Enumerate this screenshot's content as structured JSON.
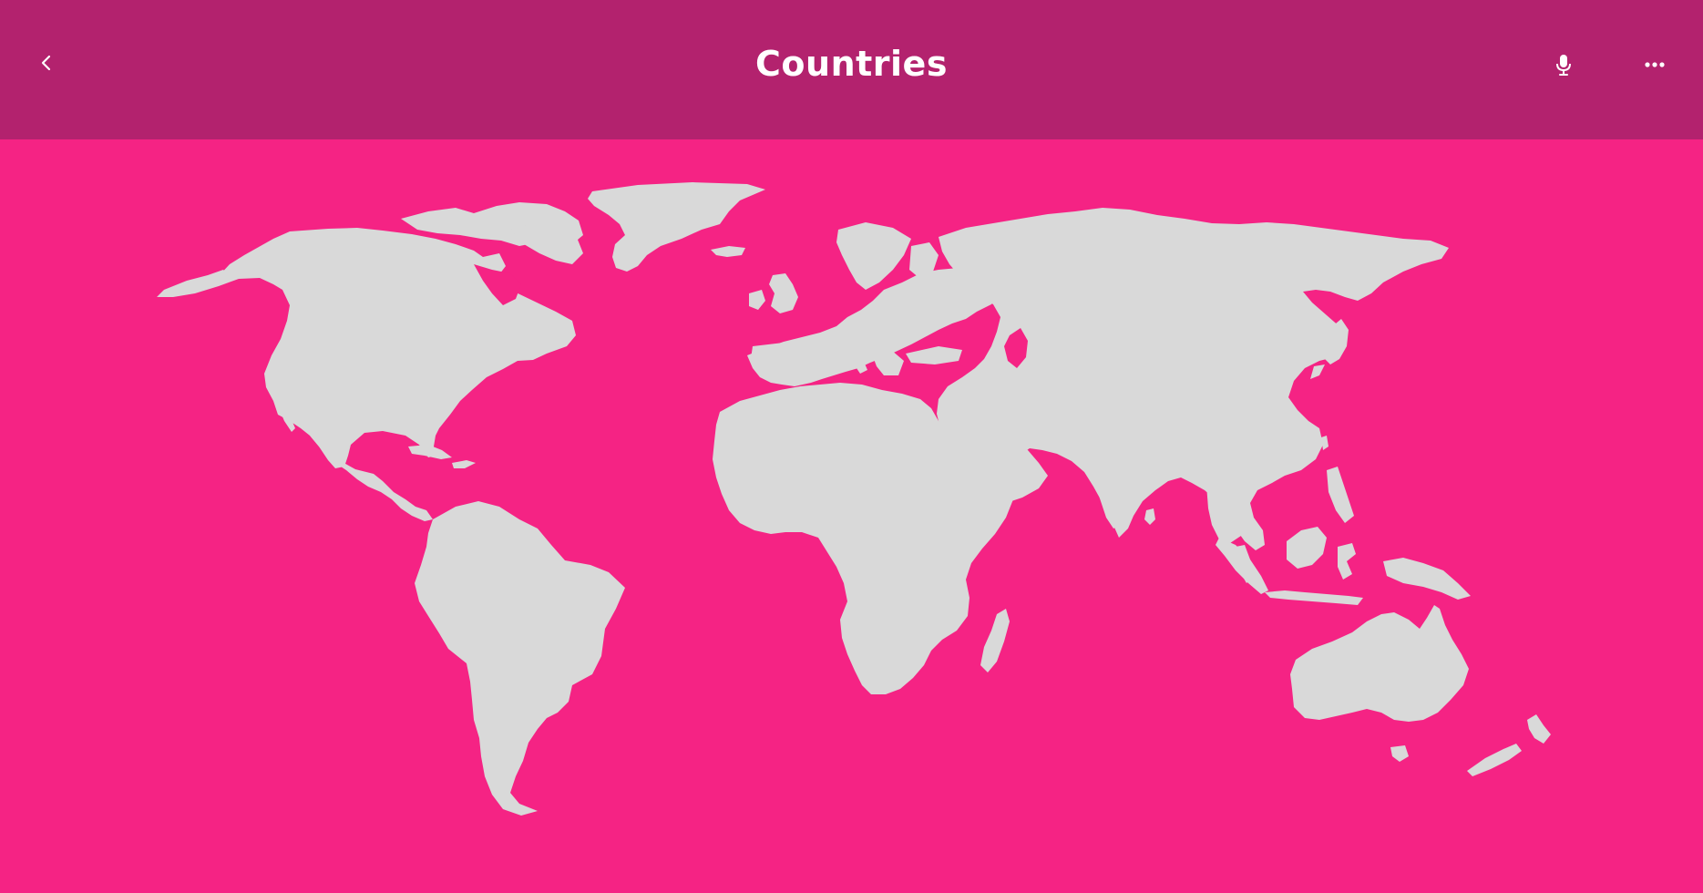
{
  "header": {
    "title": "Countries",
    "background": "#B3226E",
    "back_icon": "chevron-left-icon",
    "mic_icon": "microphone-icon",
    "more_icon": "more-horizontal-icon"
  },
  "map": {
    "background": "#F52384",
    "land_color": "#D9D9D9",
    "regions": [
      "north-america",
      "greenland",
      "arctic-islands",
      "central-america",
      "caribbean",
      "south-america",
      "europe",
      "british-isles",
      "iceland",
      "scandinavia",
      "africa",
      "madagascar",
      "middle-east",
      "asia",
      "japan",
      "southeast-asia",
      "indonesia",
      "new-guinea",
      "australia",
      "new-zealand",
      "tasmania"
    ]
  }
}
